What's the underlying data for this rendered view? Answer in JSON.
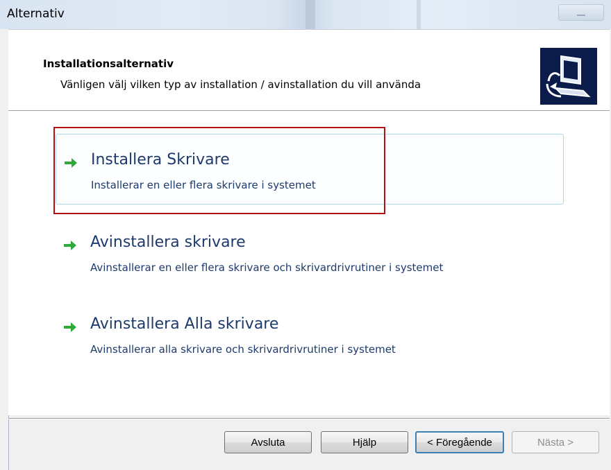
{
  "window": {
    "title": "Alternativ"
  },
  "header": {
    "title": "Installationsalternativ",
    "subtitle": "Vänligen välj vilken typ av installation / avinstallation du vill använda",
    "icon": "computer-setup-icon"
  },
  "options": [
    {
      "title": "Installera Skrivare",
      "description": "Installerar en eller flera skrivare i systemet",
      "icon": "green-arrow-icon",
      "selected": true
    },
    {
      "title": "Avinstallera skrivare",
      "description": "Avinstallerar en eller flera skrivare och skrivardrivrutiner i systemet",
      "icon": "green-arrow-icon",
      "selected": false
    },
    {
      "title": "Avinstallera Alla skrivare",
      "description": "Avinstallerar alla skrivare och skrivardrivrutiner i systemet",
      "icon": "green-arrow-icon",
      "selected": false
    }
  ],
  "buttons": {
    "exit": "Avsluta",
    "help": "Hjälp",
    "previous": "< Föregående",
    "next": "Nästa >",
    "next_disabled": true
  },
  "colors": {
    "option_text": "#1d3a6c",
    "arrow_green": "#2fa93a",
    "highlight_border": "#b01010",
    "hover_border": "#a8dcf4"
  }
}
